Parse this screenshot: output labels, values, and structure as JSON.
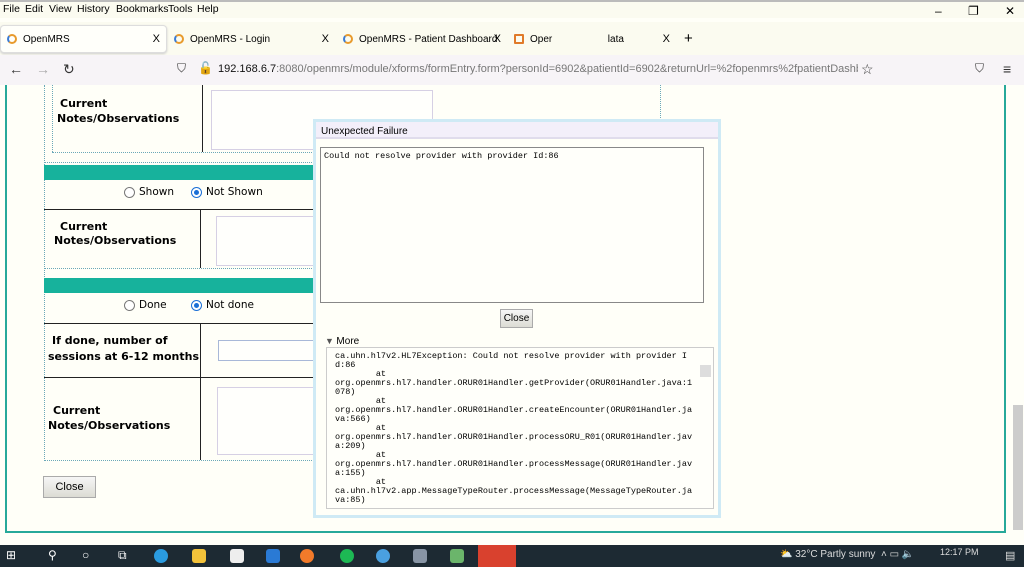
{
  "menu": [
    "File",
    "Edit",
    "View",
    "History",
    "Bookmarks",
    "Tools",
    "Help"
  ],
  "tabs": [
    {
      "title": "OpenMRS",
      "active": true
    },
    {
      "title": "OpenMRS - Login"
    },
    {
      "title": "OpenMRS - Patient Dashboard"
    },
    {
      "title": "Oper                    lata"
    }
  ],
  "new_tab": "+",
  "close_glyph": "X",
  "url": {
    "host": "192.168.6.7",
    "rest": ":8080/openmrs/module/xforms/formEntry.form?personId=6902&patientId=6902&returnUrl=%2fopenmrs%2fpatientDashboa"
  },
  "form": {
    "notes_label1": "Current",
    "notes_label2": "Notes/Observations",
    "radios1": [
      {
        "label": "Shown",
        "checked": false
      },
      {
        "label": "Not Shown",
        "checked": true
      }
    ],
    "radios2": [
      {
        "label": "Done",
        "checked": false
      },
      {
        "label": "Not done",
        "checked": true
      }
    ],
    "sessions_label1": "If done, number of",
    "sessions_label2": "sessions at 6-12 months",
    "close": "Close"
  },
  "dialog": {
    "title": "Unexpected Failure",
    "message": "Could not resolve provider with provider Id:86",
    "close": "Close",
    "more": "More",
    "stack": "ca.uhn.hl7v2.HL7Exception: Could not resolve provider with provider Id:86\n        at\norg.openmrs.hl7.handler.ORUR01Handler.getProvider(ORUR01Handler.java:1078)\n        at\norg.openmrs.hl7.handler.ORUR01Handler.createEncounter(ORUR01Handler.java:566)\n        at\norg.openmrs.hl7.handler.ORUR01Handler.processORU_R01(ORUR01Handler.java:209)\n        at\norg.openmrs.hl7.handler.ORUR01Handler.processMessage(ORUR01Handler.java:155)\n        at\nca.uhn.hl7v2.app.MessageTypeRouter.processMessage(MessageTypeRouter.java:85)"
  },
  "taskbar": {
    "weather": "32°C  Partly sunny",
    "time": "12:17 PM"
  },
  "colors": {
    "accent": "#17b29c",
    "frame": "#27a99a",
    "taskbar": "#1d2a33"
  }
}
